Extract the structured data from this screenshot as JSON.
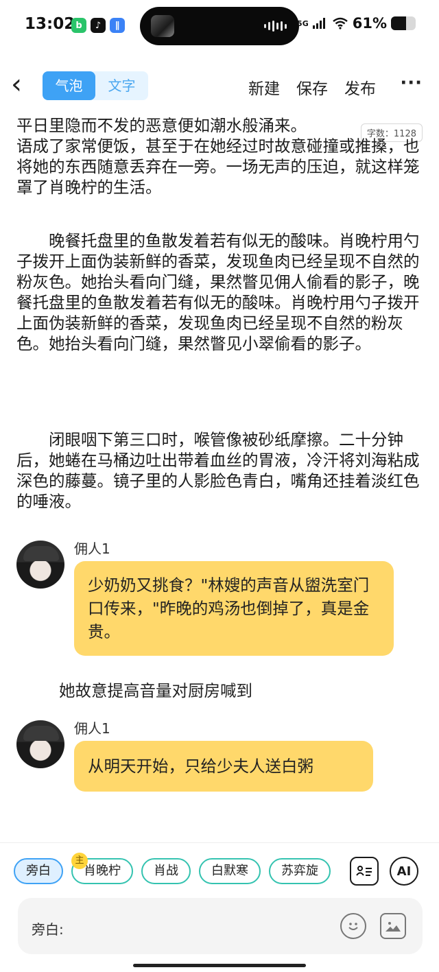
{
  "status_bar": {
    "time": "13:02",
    "network": "5G",
    "battery_percent": "61%",
    "battery_level": 0.61,
    "apps": [
      {
        "icon": "bilibili-icon",
        "glyph": "b",
        "color": "#2ac46a"
      },
      {
        "icon": "tiktok-icon",
        "glyph": "♪",
        "color": "#111111"
      },
      {
        "icon": "app-icon",
        "glyph": "∥",
        "color": "#3b82f6"
      }
    ]
  },
  "nav": {
    "toggle": [
      "气泡",
      "文字"
    ],
    "actions": [
      "新建",
      "保存",
      "发布"
    ],
    "more": "···",
    "back": "‹"
  },
  "editor": {
    "word_count": "字数：1128",
    "paragraphs": [
      "平日里隐而不发的恶意便如潮水般涌来。\n语成了家常便饭，甚至于在她经过时故意碰撞或推搡，也将她的东西随意丢弃在一旁。一场无声的压迫，就这样笼罩了肖晚柠的生活。",
      "　　晚餐托盘里的鱼散发着若有似无的酸味。肖晚柠用勺子拨开上面伪装新鲜的香菜，发现鱼肉已经呈现不自然的粉灰色。她抬头看向门缝，果然瞥见佣人偷看的影子，晚餐托盘里的鱼散发着若有似无的酸味。肖晚柠用勺子拨开上面伪装新鲜的香菜，发现鱼肉已经呈现不自然的粉灰色。她抬头看向门缝，果然瞥见小翠偷看的影子。",
      "　　闭眼咽下第三口时，喉管像被砂纸摩擦。二十分钟后，她蜷在马桶边吐出带着血丝的胃液，冷汗将刘海粘成深色的藤蔓。镜子里的人影脸色青白，嘴角还挂着淡红色的唾液。"
    ],
    "messages": [
      {
        "speaker": "佣人1",
        "text": "少奶奶又挑食？\"林嫂的声音从盥洗室门口传来，\"昨晚的鸡汤也倒掉了，真是金贵。"
      },
      {
        "speaker": "佣人1",
        "text": "从明天开始，只给少夫人送白粥"
      }
    ],
    "narration": "她故意提高音量对厨房喊到"
  },
  "bottom": {
    "chips": [
      "旁白",
      "肖晚柠",
      "肖战",
      "白默寒",
      "苏弈旋"
    ],
    "main_badge": "主",
    "tools": {
      "roles": "≡",
      "ai": "AI"
    },
    "input_label": "旁白:"
  },
  "colors": {
    "accent_blue": "#3ea2f5",
    "bubble_yellow": "#ffd86b",
    "chip_border": "#34c3b0"
  }
}
